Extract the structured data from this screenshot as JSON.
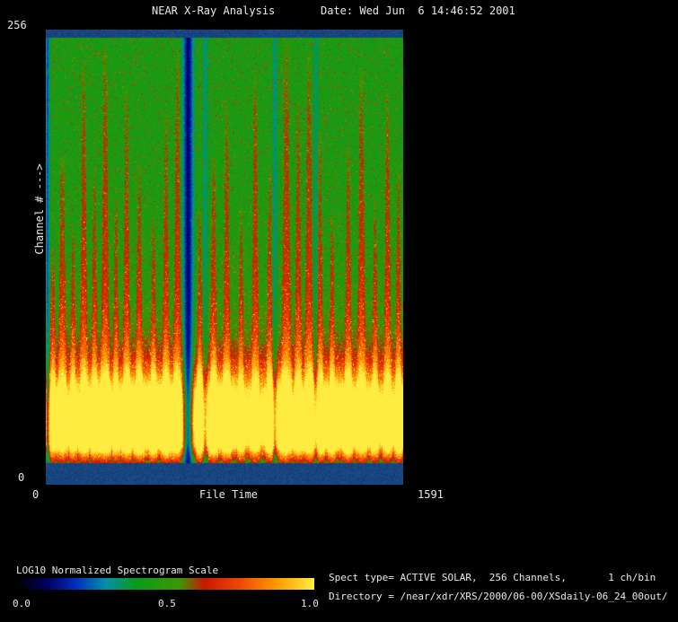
{
  "header": {
    "title": "NEAR X-Ray Analysis",
    "date": "Date: Wed Jun  6 14:46:52 2001"
  },
  "axes": {
    "ylabel": "Channel # --->",
    "xlabel": "File Time",
    "y_top": "256",
    "y_bottom": "0",
    "x_left": "0",
    "x_right": "1591"
  },
  "legend": {
    "label": "LOG10 Normalized Spectrogram Scale",
    "tick_left": "0.0",
    "tick_mid": "0.5",
    "tick_right": "1.0"
  },
  "info": {
    "spect_line": "Spect type= ACTIVE SOLAR,  256 Channels,       1 ch/bin",
    "directory_line": "Directory = /near/xdr/XRS/2000/06-00/XSdaily-06_24_00out/"
  },
  "chart_data": {
    "type": "heatmap",
    "title": "NEAR X-Ray Analysis",
    "xlabel": "File Time",
    "ylabel": "Channel # --->",
    "x_range": [
      0,
      1591
    ],
    "y_range": [
      0,
      256
    ],
    "x_ticks": [
      0,
      1591
    ],
    "y_ticks": [
      0,
      256
    ],
    "colorbar": {
      "label": "LOG10 Normalized Spectrogram Scale",
      "ticks": [
        0.0,
        0.5,
        1.0
      ],
      "range": [
        0.0,
        1.0
      ]
    },
    "colormap": [
      [
        0.0,
        "#000000"
      ],
      [
        0.1,
        "#000060"
      ],
      [
        0.2,
        "#0030c0"
      ],
      [
        0.3,
        "#0090a8"
      ],
      [
        0.4,
        "#089c1c"
      ],
      [
        0.55,
        "#3f9800"
      ],
      [
        0.63,
        "#c81800"
      ],
      [
        0.75,
        "#f04800"
      ],
      [
        0.86,
        "#ff9000"
      ],
      [
        1.0,
        "#ffec40"
      ]
    ],
    "description": "LOG10-normalized X-ray spectrogram, 256 channels vs file time 0-1591 (1 ch/bin, ACTIVE SOLAR). Bright saturated yellow-orange band in low channels, vertical red flare streaks extending toward high channels over a speckled green background, dark blue bands along top and bottom edges, and a dark dropout column near x~0.4 of the record.",
    "render": {
      "seed": 1234567,
      "band_color": "#174580",
      "top_band": 0.016,
      "bottom_band": 0.047,
      "base_green": 0.45,
      "yellow_center": 0.1,
      "yellow_sigma": 0.075,
      "yellow_amp": 0.55,
      "streaks": [
        [
          0.018,
          0.5,
          0.006
        ],
        [
          0.045,
          0.72,
          0.007
        ],
        [
          0.075,
          0.55,
          0.005
        ],
        [
          0.105,
          0.95,
          0.006
        ],
        [
          0.135,
          0.7,
          0.005
        ],
        [
          0.165,
          0.98,
          0.007
        ],
        [
          0.195,
          0.62,
          0.005
        ],
        [
          0.225,
          0.88,
          0.006
        ],
        [
          0.26,
          0.7,
          0.006
        ],
        [
          0.3,
          0.58,
          0.005
        ],
        [
          0.335,
          0.82,
          0.006
        ],
        [
          0.368,
          0.97,
          0.007
        ],
        [
          0.43,
          0.6,
          0.005
        ],
        [
          0.468,
          0.72,
          0.006
        ],
        [
          0.505,
          0.86,
          0.006
        ],
        [
          0.545,
          0.6,
          0.005
        ],
        [
          0.585,
          0.92,
          0.006
        ],
        [
          0.625,
          0.7,
          0.005
        ],
        [
          0.672,
          0.99,
          0.008
        ],
        [
          0.705,
          0.85,
          0.006
        ],
        [
          0.735,
          0.96,
          0.007
        ],
        [
          0.765,
          0.78,
          0.006
        ],
        [
          0.8,
          0.58,
          0.005
        ],
        [
          0.845,
          0.74,
          0.006
        ],
        [
          0.882,
          0.92,
          0.007
        ],
        [
          0.92,
          0.62,
          0.005
        ],
        [
          0.955,
          0.88,
          0.006
        ],
        [
          0.985,
          0.7,
          0.005
        ]
      ],
      "gaps": [
        [
          0.004,
          0.5,
          0.004
        ],
        [
          0.397,
          0.78,
          0.01
        ],
        [
          0.445,
          0.28,
          0.005
        ],
        [
          0.64,
          0.33,
          0.004
        ],
        [
          0.755,
          0.28,
          0.004
        ]
      ]
    }
  }
}
